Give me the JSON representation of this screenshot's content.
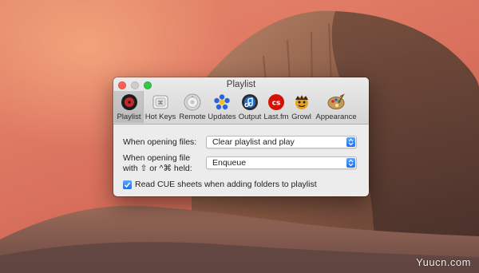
{
  "window": {
    "title": "Playlist"
  },
  "toolbar": {
    "items": [
      {
        "label": "Playlist",
        "icon": "playlist-icon",
        "selected": true
      },
      {
        "label": "Hot Keys",
        "icon": "hotkeys-icon",
        "selected": false
      },
      {
        "label": "Remote",
        "icon": "remote-icon",
        "selected": false
      },
      {
        "label": "Updates",
        "icon": "updates-icon",
        "selected": false
      },
      {
        "label": "Output",
        "icon": "output-icon",
        "selected": false
      },
      {
        "label": "Last.fm",
        "icon": "lastfm-icon",
        "selected": false
      },
      {
        "label": "Growl",
        "icon": "growl-icon",
        "selected": false
      },
      {
        "label": "Appearance",
        "icon": "appearance-icon",
        "selected": false
      }
    ]
  },
  "settings": {
    "opening_files_label": "When opening files:",
    "opening_files_value": "Clear playlist and play",
    "opening_modifier_label_line1": "When opening file",
    "opening_modifier_label_line2": "with ⇧ or ^⌘ held:",
    "opening_modifier_value": "Enqueue",
    "read_cue_label": "Read CUE sheets when adding folders to playlist",
    "read_cue_checked": true
  },
  "watermark": {
    "text": "Yuucn.com"
  },
  "colors": {
    "accent": "#2f7ff5",
    "close": "#fc605b",
    "zoom": "#34c84a"
  }
}
